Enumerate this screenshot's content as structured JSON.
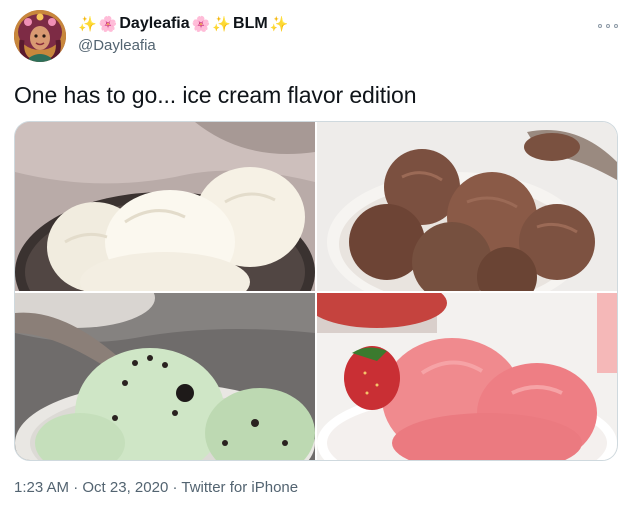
{
  "tweet": {
    "display_name": {
      "prefix_emoji_1": "✨",
      "prefix_emoji_2": "🌸",
      "name": "Dayleafia",
      "mid_emoji_1": "🌸",
      "mid_emoji_2": "✨",
      "suffix": "BLM",
      "suffix_emoji": "✨"
    },
    "handle": "@Dayleafia",
    "text": "One has to go... ice cream flavor edition",
    "time": "1:23 AM",
    "separator_1": "·",
    "date": "Oct 23, 2020",
    "separator_2": "·",
    "source": "Twitter for iPhone"
  },
  "media": {
    "photos": [
      {
        "depicts": "vanilla-ice-cream"
      },
      {
        "depicts": "chocolate-ice-cream"
      },
      {
        "depicts": "mint-chocolate-chip-ice-cream"
      },
      {
        "depicts": "strawberry-ice-cream"
      }
    ]
  },
  "icons": {
    "more": "more-options-icon"
  },
  "colors": {
    "text_primary": "#0f1419",
    "text_secondary": "#536471",
    "border": "#cfd9de"
  }
}
